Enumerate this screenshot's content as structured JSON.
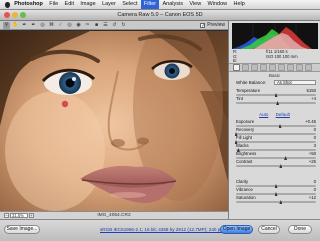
{
  "menubar": {
    "app": "Photoshop",
    "items": [
      "File",
      "Edit",
      "Image",
      "Layer",
      "Select",
      "Filter",
      "Analysis",
      "View",
      "Window",
      "Help"
    ],
    "active_index": 5
  },
  "window": {
    "title": "Camera Raw 5.0  –  Canon EOS 5D"
  },
  "toolbar": {
    "tools": [
      "zoom-icon",
      "hand-icon",
      "eyedropper-icon",
      "color-sampler-icon",
      "target-adjust-icon",
      "crop-icon",
      "straighten-icon",
      "spot-removal-icon",
      "red-eye-icon",
      "adjustment-brush-icon",
      "graduated-filter-icon",
      "preferences-icon",
      "rotate-left-icon",
      "rotate-right-icon"
    ],
    "preview_label": "Preview",
    "preview_checked": true
  },
  "status": {
    "zoom": "31.5%",
    "filename": "IMG_4054.CR2"
  },
  "info": {
    "rgb": [
      "R:",
      "G:",
      "B:"
    ],
    "camera": [
      "f/11   1/160 s",
      "ISO 100   100 mm"
    ]
  },
  "panel": {
    "section": "Basic",
    "white_balance_label": "White Balance:",
    "white_balance_value": "As Shot",
    "auto_label": "Auto",
    "default_label": "Default",
    "sliders": [
      {
        "label": "Temperature",
        "value": "5150",
        "pos": 0.5
      },
      {
        "label": "Tint",
        "value": "+4",
        "pos": 0.52
      },
      {
        "label": "Exposure",
        "value": "+0.45",
        "pos": 0.55
      },
      {
        "label": "Recovery",
        "value": "0",
        "pos": 0.0
      },
      {
        "label": "Fill Light",
        "value": "0",
        "pos": 0.0
      },
      {
        "label": "Blacks",
        "value": "3",
        "pos": 0.03
      },
      {
        "label": "Brightness",
        "value": "+50",
        "pos": 0.62
      },
      {
        "label": "Contrast",
        "value": "+25",
        "pos": 0.56
      },
      {
        "label": "Clarity",
        "value": "0",
        "pos": 0.5
      },
      {
        "label": "Vibrance",
        "value": "0",
        "pos": 0.5
      },
      {
        "label": "Saturation",
        "value": "+12",
        "pos": 0.56
      }
    ]
  },
  "bottom": {
    "save": "Save Image...",
    "workflow": "sRGB IEC61966-2.1; 16 bit; 4368 by 2912 (12.7MP); 240 ppi",
    "open": "Open Image",
    "cancel": "Cancel",
    "done": "Done"
  }
}
